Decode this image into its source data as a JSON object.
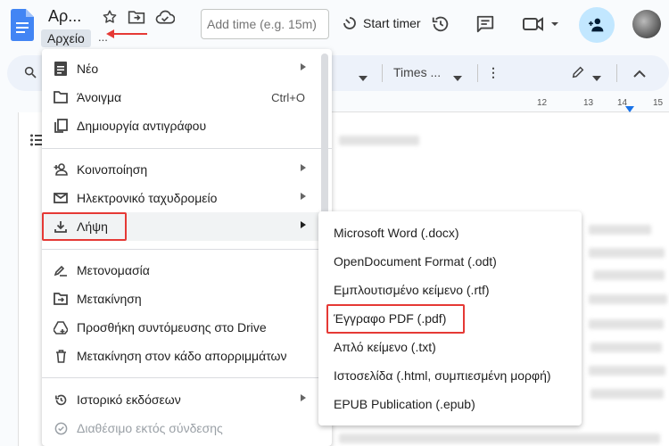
{
  "header": {
    "doc_title": "Αρ...",
    "menu_file_label": "Αρχείο",
    "menu_more": "...",
    "add_time_placeholder": "Add time (e.g. 15m)",
    "start_timer_label": "Start timer"
  },
  "toolbar": {
    "style_dropdown": "",
    "font_dropdown": "Times ...",
    "more": "⋮"
  },
  "ruler": {
    "ticks": [
      "",
      "",
      "",
      "",
      "",
      "",
      "",
      "",
      "",
      "12",
      "",
      "13",
      "",
      "14",
      "",
      "15"
    ]
  },
  "file_menu": {
    "items": [
      {
        "label": "Νέο",
        "icon": "new-doc-icon",
        "submenu": true
      },
      {
        "label": "Άνοιγμα",
        "icon": "folder-icon",
        "shortcut": "Ctrl+O"
      },
      {
        "label": "Δημιουργία αντιγράφου",
        "icon": "copy-icon"
      },
      {
        "label": "Κοινοποίηση",
        "icon": "person-add-icon",
        "submenu": true
      },
      {
        "label": "Ηλεκτρονικό ταχυδρομείο",
        "icon": "mail-icon",
        "submenu": true
      },
      {
        "label": "Λήψη",
        "icon": "download-icon",
        "submenu": true,
        "highlighted": true
      },
      {
        "label": "Μετονομασία",
        "icon": "rename-icon"
      },
      {
        "label": "Μετακίνηση",
        "icon": "move-folder-icon"
      },
      {
        "label": "Προσθήκη συντόμευσης στο Drive",
        "icon": "drive-shortcut-icon"
      },
      {
        "label": "Μετακίνηση στον κάδο απορριμμάτων",
        "icon": "trash-icon"
      },
      {
        "label": "Ιστορικό εκδόσεων",
        "icon": "history-icon",
        "submenu": true
      },
      {
        "label": "Διαθέσιμο εκτός σύνδεσης",
        "icon": "offline-icon",
        "disabled": true
      }
    ]
  },
  "download_submenu": {
    "items": [
      {
        "label": "Microsoft Word (.docx)"
      },
      {
        "label": "OpenDocument Format (.odt)"
      },
      {
        "label": "Εμπλουτισμένο κείμενο (.rtf)"
      },
      {
        "label": "Έγγραφο PDF (.pdf)",
        "highlighted": true
      },
      {
        "label": "Απλό κείμενο (.txt)"
      },
      {
        "label": "Ιστοσελίδα (.html, συμπιεσμένη μορφή)"
      },
      {
        "label": "EPUB Publication (.epub)"
      }
    ]
  },
  "colors": {
    "accent": "#1a73e8",
    "highlight_border": "#e53935",
    "share_button_bg": "#c2e7ff"
  }
}
